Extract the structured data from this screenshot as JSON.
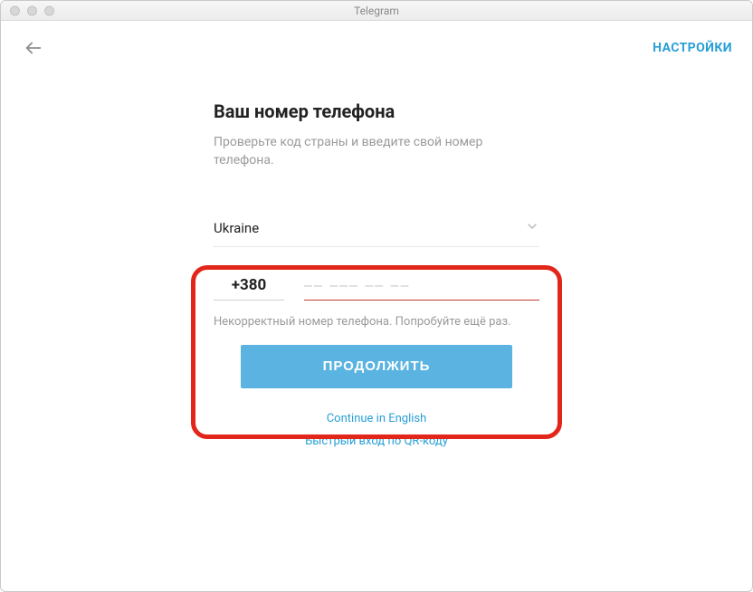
{
  "window": {
    "title": "Telegram"
  },
  "toprow": {
    "settings": "НАСТРОЙКИ"
  },
  "heading": "Ваш номер телефона",
  "subtitle": "Проверьте код страны и введите свой номер телефона.",
  "country": {
    "name": "Ukraine"
  },
  "phone": {
    "code": "+380",
    "placeholder": "–– ––– –– ––",
    "value": ""
  },
  "error": "Некорректный номер телефона. Попробуйте ещё раз.",
  "continue": "ПРОДОЛЖИТЬ",
  "links": {
    "english": "Continue in English",
    "qr": "Быстрый вход по QR-коду"
  },
  "colors": {
    "accent": "#5ab3e0",
    "link": "#2a9fd6",
    "error_underline": "#c23a2f",
    "callout": "#e2261a"
  }
}
